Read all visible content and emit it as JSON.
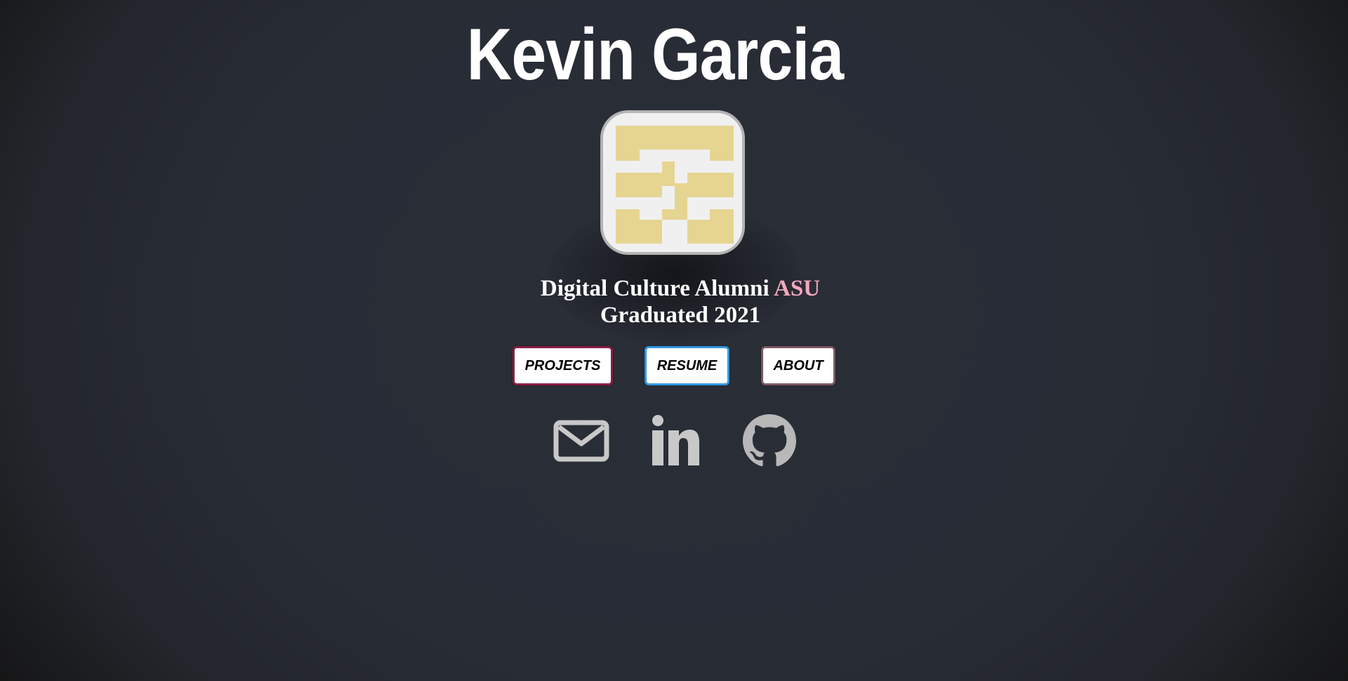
{
  "header": {
    "name": "Kevin Garcia"
  },
  "logo": {
    "icon": "greek-key-monogram-icon",
    "tile_color": "#f0f0f0",
    "glyph_color": "#e6d591",
    "border_color": "#b3b3b3"
  },
  "tagline": {
    "line1_prefix": "Digital Culture Alumni",
    "school": "ASU",
    "line2": "Graduated 2021",
    "school_color": "#f4a7bd"
  },
  "nav": {
    "projects_label": "PROJECTS",
    "resume_label": "RESUME",
    "about_label": "ABOUT",
    "projects_color": "#8c1b43",
    "resume_color": "#2f98e1",
    "about_color": "#7d5760"
  },
  "social": [
    {
      "icon": "email-icon"
    },
    {
      "icon": "linkedin-icon"
    },
    {
      "icon": "github-icon"
    }
  ],
  "colors": {
    "background": "#282c35",
    "text": "#ffffff",
    "icon": "#c8c8c8"
  }
}
